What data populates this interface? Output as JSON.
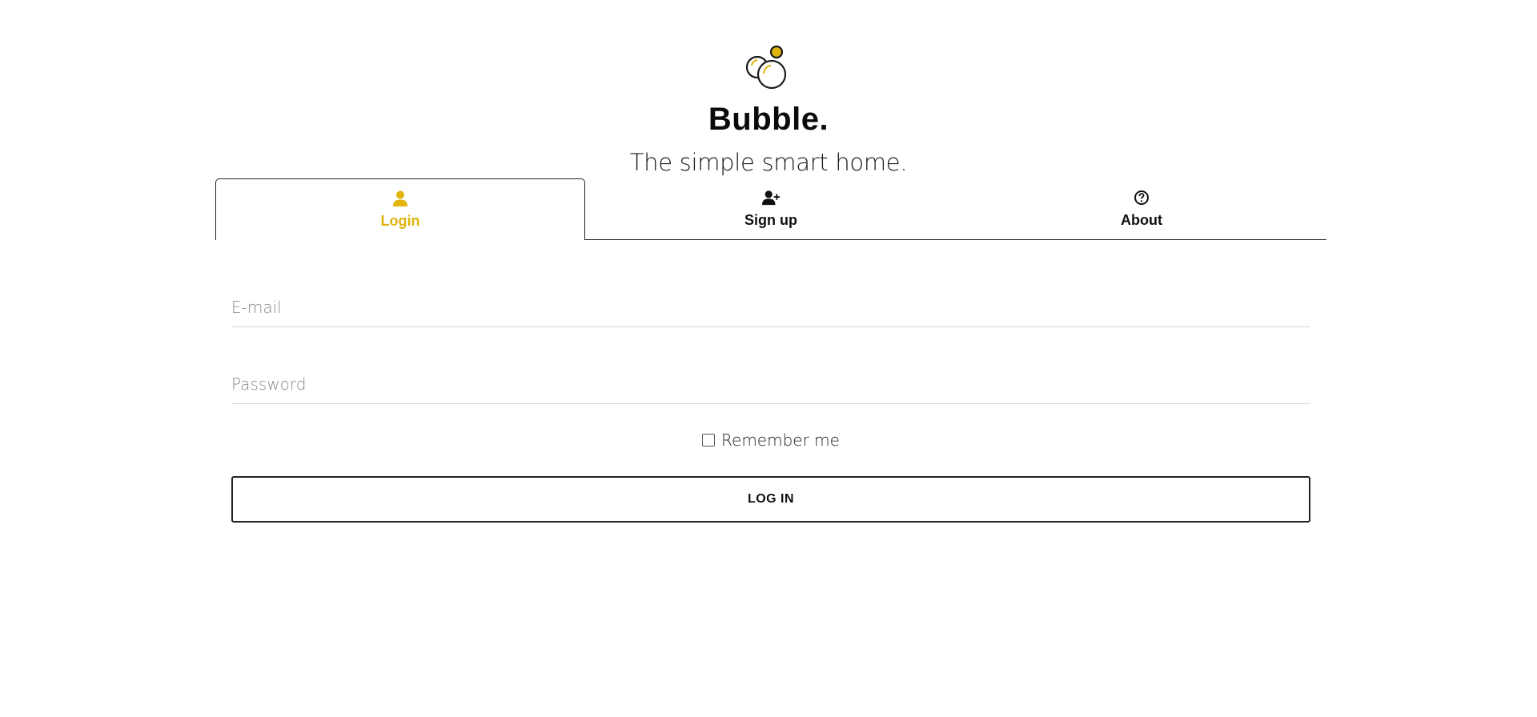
{
  "brand": {
    "title": "Bubble.",
    "tagline": "The simple smart home.",
    "logo_icon": "bubbles-logo-icon",
    "accent_color": "#e0b40c"
  },
  "tabs": [
    {
      "label": "Login",
      "icon": "user-icon",
      "active": true
    },
    {
      "label": "Sign up",
      "icon": "user-plus-icon",
      "active": false
    },
    {
      "label": "About",
      "icon": "question-circle-icon",
      "active": false
    }
  ],
  "form": {
    "email_placeholder": "E-mail",
    "email_value": "",
    "password_placeholder": "Password",
    "password_value": "",
    "remember_label": "Remember me",
    "remember_checked": false,
    "submit_label": "LOG IN"
  }
}
